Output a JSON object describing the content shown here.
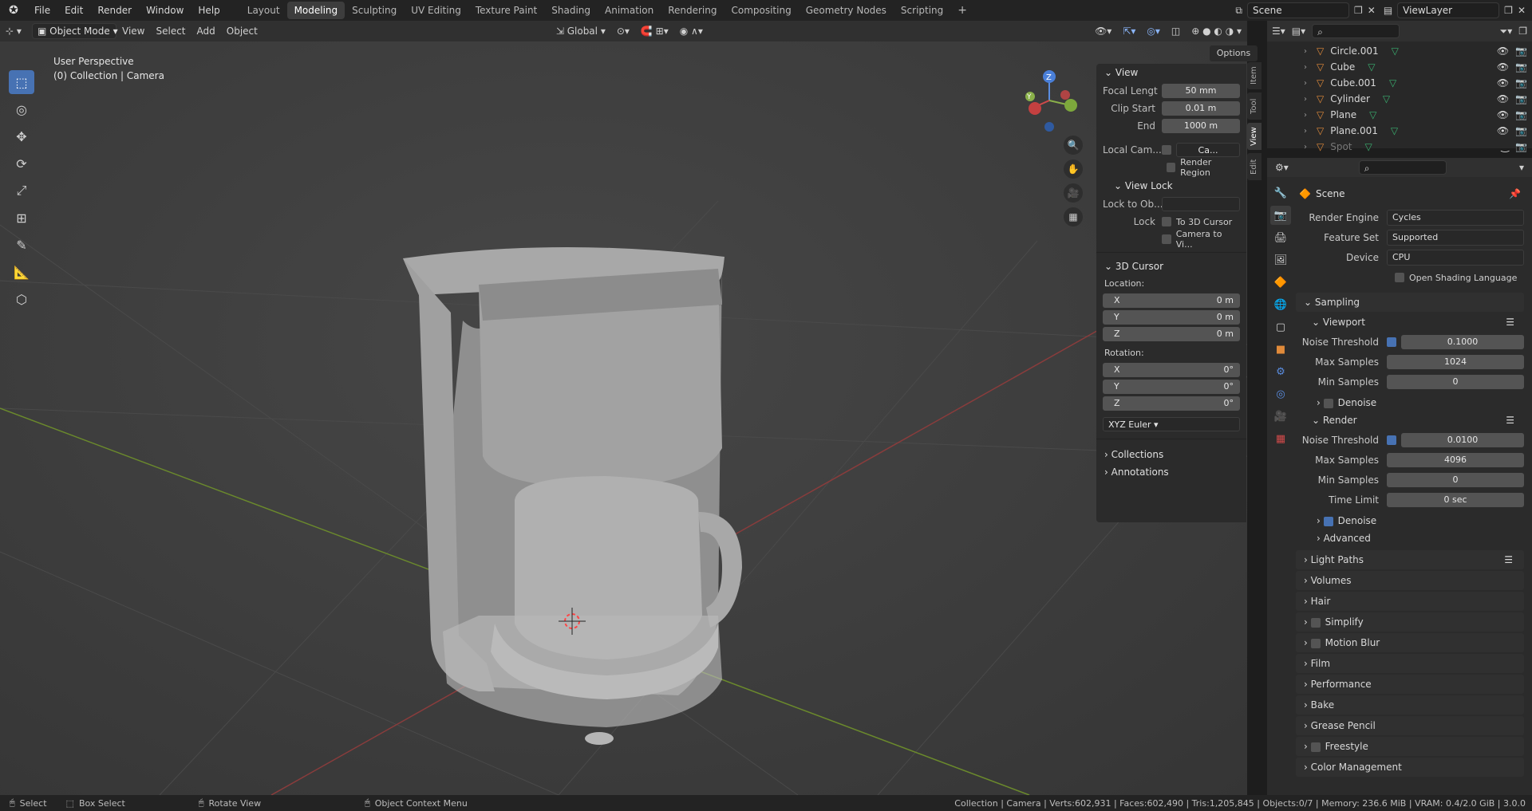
{
  "topbar": {
    "menus": [
      "File",
      "Edit",
      "Render",
      "Window",
      "Help"
    ],
    "workspaces": [
      "Layout",
      "Modeling",
      "Sculpting",
      "UV Editing",
      "Texture Paint",
      "Shading",
      "Animation",
      "Rendering",
      "Compositing",
      "Geometry Nodes",
      "Scripting"
    ],
    "active_workspace": "Modeling",
    "scene": "Scene",
    "view_layer": "ViewLayer"
  },
  "header": {
    "mode": "Object Mode",
    "menus": [
      "View",
      "Select",
      "Add",
      "Object"
    ],
    "orientation": "Global",
    "options": "Options"
  },
  "viewport": {
    "perspective": "User Perspective",
    "collection": "(0) Collection | Camera"
  },
  "npanel": {
    "tabs": [
      "Item",
      "Tool",
      "View",
      "Edit"
    ],
    "active_tab": "View",
    "view_title": "View",
    "focal_label": "Focal Lengt",
    "focal_value": "50 mm",
    "clip_start_label": "Clip Start",
    "clip_start_value": "0.01 m",
    "end_label": "End",
    "end_value": "1000 m",
    "local_cam_label": "Local Cam...",
    "local_cam_value": "Ca...",
    "render_region": "Render Region",
    "view_lock": "View Lock",
    "lock_to_label": "Lock to Ob...",
    "lock_label": "Lock",
    "to_3d_cursor": "To 3D Cursor",
    "camera_to_view": "Camera to Vi...",
    "cursor_title": "3D Cursor",
    "location_label": "Location:",
    "loc": [
      {
        "axis": "X",
        "value": "0 m"
      },
      {
        "axis": "Y",
        "value": "0 m"
      },
      {
        "axis": "Z",
        "value": "0 m"
      }
    ],
    "rotation_label": "Rotation:",
    "rot": [
      {
        "axis": "X",
        "value": "0°"
      },
      {
        "axis": "Y",
        "value": "0°"
      },
      {
        "axis": "Z",
        "value": "0°"
      }
    ],
    "rotation_mode": "XYZ Euler",
    "collections": "Collections",
    "annotations": "Annotations"
  },
  "outliner": {
    "items": [
      {
        "name": "Circle.001",
        "visible": true
      },
      {
        "name": "Cube",
        "visible": true
      },
      {
        "name": "Cube.001",
        "visible": true
      },
      {
        "name": "Cylinder",
        "visible": true
      },
      {
        "name": "Plane",
        "visible": true
      },
      {
        "name": "Plane.001",
        "visible": true
      },
      {
        "name": "Spot",
        "visible": false
      }
    ]
  },
  "properties": {
    "scene": "Scene",
    "render_engine_label": "Render Engine",
    "render_engine": "Cycles",
    "feature_set_label": "Feature Set",
    "feature_set": "Supported",
    "device_label": "Device",
    "device": "CPU",
    "osl": "Open Shading Language",
    "sampling": "Sampling",
    "viewport": "Viewport",
    "vp_noise_label": "Noise Threshold",
    "vp_noise": "0.1000",
    "vp_max_label": "Max Samples",
    "vp_max": "1024",
    "vp_min_label": "Min Samples",
    "vp_min": "0",
    "vp_denoise": "Denoise",
    "render": "Render",
    "r_noise_label": "Noise Threshold",
    "r_noise": "0.0100",
    "r_max_label": "Max Samples",
    "r_max": "4096",
    "r_min_label": "Min Samples",
    "r_min": "0",
    "time_limit_label": "Time Limit",
    "time_limit": "0 sec",
    "r_denoise": "Denoise",
    "advanced": "Advanced",
    "sections": [
      "Light Paths",
      "Volumes",
      "Hair",
      "Simplify",
      "Motion Blur",
      "Film",
      "Performance",
      "Bake",
      "Grease Pencil",
      "Freestyle",
      "Color Management"
    ]
  },
  "statusbar": {
    "select": "Select",
    "box_select": "Box Select",
    "rotate_view": "Rotate View",
    "context_menu": "Object Context Menu",
    "stats": "Collection | Camera | Verts:602,931 | Faces:602,490 | Tris:1,205,845 | Objects:0/7 | Memory: 236.6 MiB | VRAM: 0.4/2.0 GiB | 3.0.0"
  }
}
